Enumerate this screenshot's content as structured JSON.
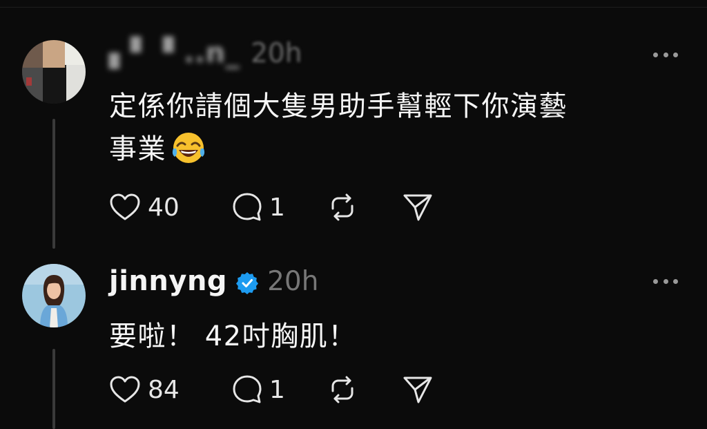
{
  "posts": [
    {
      "username": "▖▘▝ ..n_",
      "time": "20h",
      "text_line1": "定係你請個大隻男助手幫輕下你演藝",
      "text_line2": "事業",
      "emoji": "😂",
      "likes": "40",
      "replies": "1",
      "verified": false,
      "icons": [
        "heart-icon",
        "comment-icon",
        "repost-icon",
        "share-icon",
        "more-icon"
      ]
    },
    {
      "username": "jinnyng",
      "time": "20h",
      "text_line1": "要啦！ 42吋胸肌！",
      "likes": "84",
      "replies": "1",
      "verified": true,
      "icons": [
        "verified-badge-icon",
        "heart-icon",
        "comment-icon",
        "repost-icon",
        "share-icon",
        "more-icon"
      ]
    }
  ],
  "colors": {
    "background": "#0b0b0b",
    "text": "#f5f5f5",
    "muted": "#777777",
    "verified": "#1d9bf0"
  }
}
